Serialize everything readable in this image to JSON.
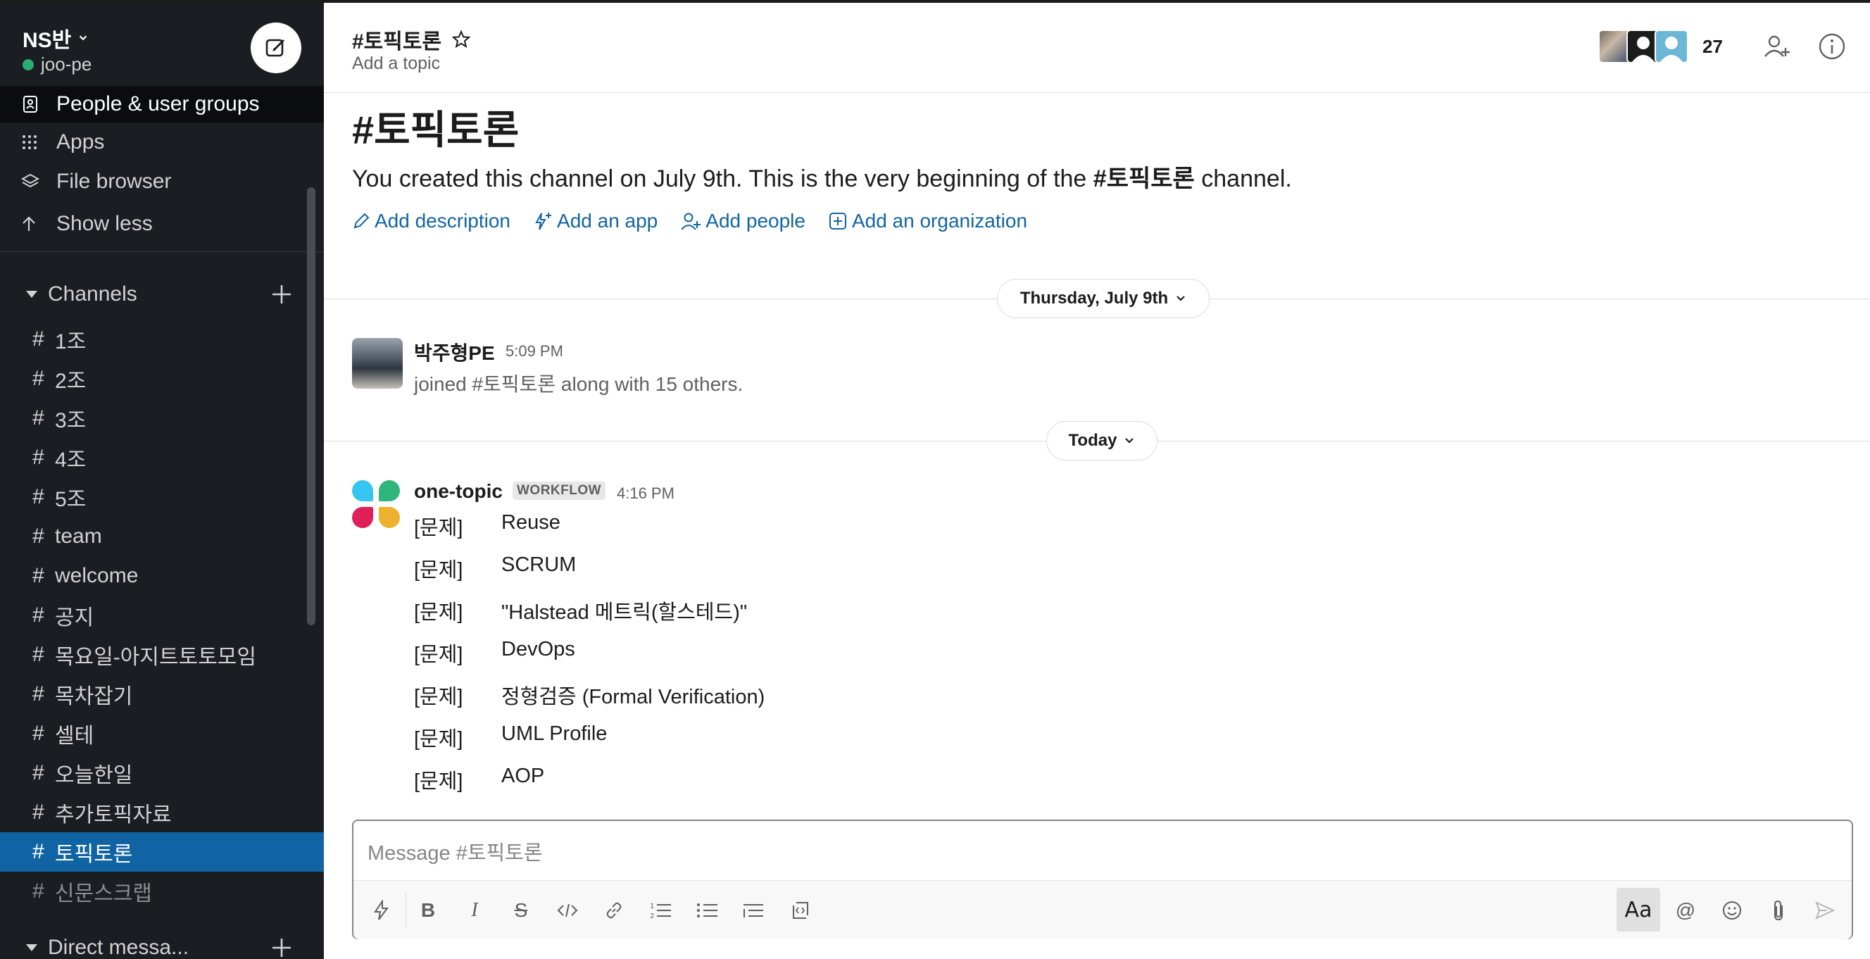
{
  "workspace": {
    "name": "NS반",
    "user": "joo-pe"
  },
  "sidebar": {
    "nav": [
      {
        "label": "People & user groups",
        "icon": "contacts-icon"
      },
      {
        "label": "Apps",
        "icon": "apps-grid-icon"
      },
      {
        "label": "File browser",
        "icon": "layers-icon"
      },
      {
        "label": "Show less",
        "icon": "arrow-up-icon"
      }
    ],
    "channels_label": "Channels",
    "channels": [
      "1조",
      "2조",
      "3조",
      "4조",
      "5조",
      "team",
      "welcome",
      "공지",
      "목요일-아지트토토모임",
      "목차잡기",
      "셀테",
      "오늘한일",
      "추가토픽자료",
      "토픽토론",
      "신문스크랩"
    ],
    "active_channel": "토픽토론",
    "dm_label": "Direct messa..."
  },
  "header": {
    "channel": "#토픽토론",
    "topic": "Add a topic",
    "member_count": "27"
  },
  "intro": {
    "title": "#토픽토론",
    "text_before": "You created this channel on July 9th. This is the very beginning of the ",
    "channel_bold": "#토픽토론",
    "text_after": " channel.",
    "actions": {
      "add_description": "Add description",
      "add_app": "Add an app",
      "add_people": "Add people",
      "add_org": "Add an organization"
    }
  },
  "dividers": {
    "first": "Thursday, July 9th",
    "second": "Today"
  },
  "messages": {
    "join": {
      "author": "박주형PE",
      "time": "5:09 PM",
      "text": "joined #토픽토론 along with 15 others."
    },
    "workflow": {
      "author": "one-topic",
      "badge": "WORKFLOW",
      "time": "4:16 PM",
      "rows": [
        {
          "k": "[문제]",
          "v": "Reuse"
        },
        {
          "k": "[문제]",
          "v": "SCRUM"
        },
        {
          "k": "[문제]",
          "v": "\"Halstead 메트릭(할스테드)\""
        },
        {
          "k": "[문제]",
          "v": "DevOps"
        },
        {
          "k": "[문제]",
          "v": "정형검증 (Formal Verification)"
        },
        {
          "k": "[문제]",
          "v": "UML Profile"
        },
        {
          "k": "[문제]",
          "v": "AOP"
        }
      ]
    }
  },
  "composer": {
    "placeholder": "Message #토픽토론",
    "format_label": "Aa"
  },
  "colors": {
    "sidebar_bg": "#1a1d21",
    "active": "#1164a3",
    "link": "#1264a3",
    "presence": "#2bac76"
  }
}
